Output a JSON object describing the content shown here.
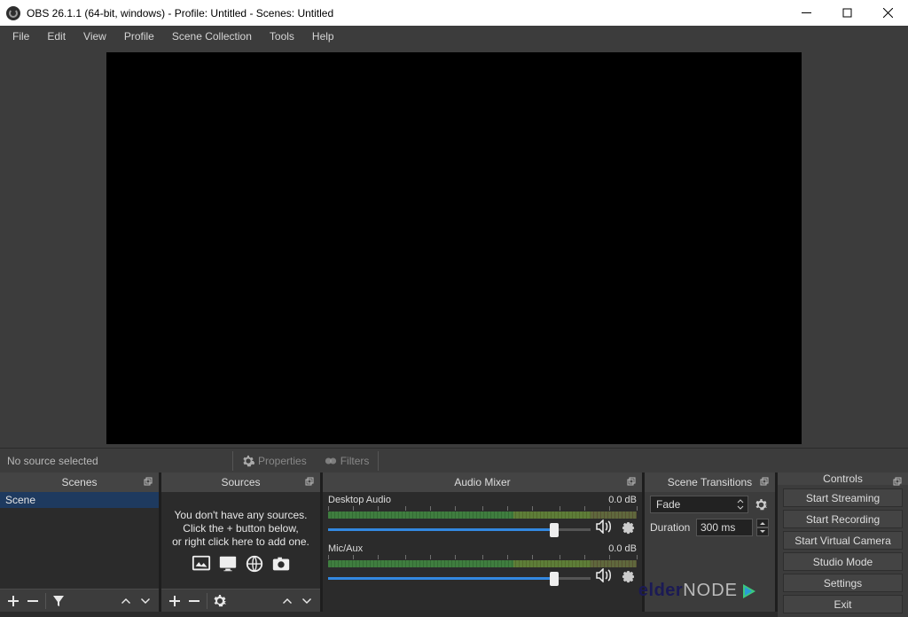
{
  "titlebar": {
    "text": "OBS 26.1.1 (64-bit, windows) - Profile: Untitled - Scenes: Untitled"
  },
  "menubar": [
    "File",
    "Edit",
    "View",
    "Profile",
    "Scene Collection",
    "Tools",
    "Help"
  ],
  "source_toolbar": {
    "no_source": "No source selected",
    "properties": "Properties",
    "filters": "Filters"
  },
  "docks": {
    "scenes": {
      "title": "Scenes",
      "items": [
        "Scene"
      ]
    },
    "sources": {
      "title": "Sources",
      "empty_lines": [
        "You don't have any sources.",
        "Click the + button below,",
        "or right click here to add one."
      ]
    },
    "mixer": {
      "title": "Audio Mixer",
      "channels": [
        {
          "name": "Desktop Audio",
          "db": "0.0 dB"
        },
        {
          "name": "Mic/Aux",
          "db": "0.0 dB"
        }
      ]
    },
    "transitions": {
      "title": "Scene Transitions",
      "selected": "Fade",
      "duration_label": "Duration",
      "duration_value": "300 ms"
    },
    "controls": {
      "title": "Controls",
      "buttons": [
        "Start Streaming",
        "Start Recording",
        "Start Virtual Camera",
        "Studio Mode",
        "Settings",
        "Exit"
      ]
    }
  },
  "watermark": {
    "a": "elder",
    "b": "NODE"
  }
}
